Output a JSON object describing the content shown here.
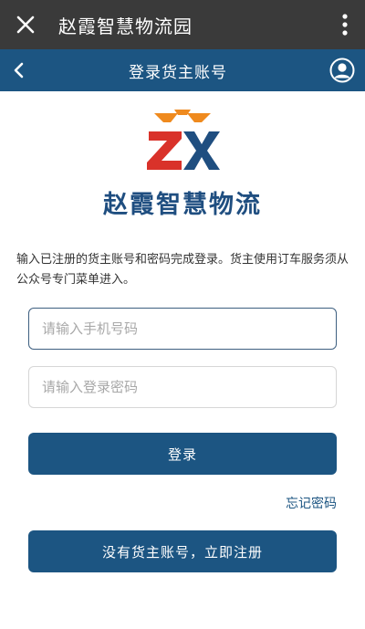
{
  "wechat_bar": {
    "title": "赵霞智慧物流园",
    "close_icon": "close-icon",
    "more_icon": "more-vertical-icon"
  },
  "nav": {
    "title": "登录货主账号",
    "back_icon": "chevron-left-icon",
    "user_icon": "user-circle-icon"
  },
  "logo": {
    "text": "赵霞智慧物流",
    "brand_colors": {
      "orange": "#ef8a1e",
      "red": "#d9322a",
      "blue": "#1f4e80"
    }
  },
  "intro_text": "输入已注册的货主账号和密码完成登录。货主使用订车服务须从公众号专门菜单进入。",
  "form": {
    "phone_placeholder": "请输入手机号码",
    "phone_value": "",
    "password_placeholder": "请输入登录密码",
    "password_value": ""
  },
  "buttons": {
    "login_label": "登录",
    "forgot_label": "忘记密码",
    "register_label": "没有货主账号，立即注册"
  },
  "colors": {
    "wechat_bar": "#3a3a3a",
    "primary": "#1c5582"
  }
}
